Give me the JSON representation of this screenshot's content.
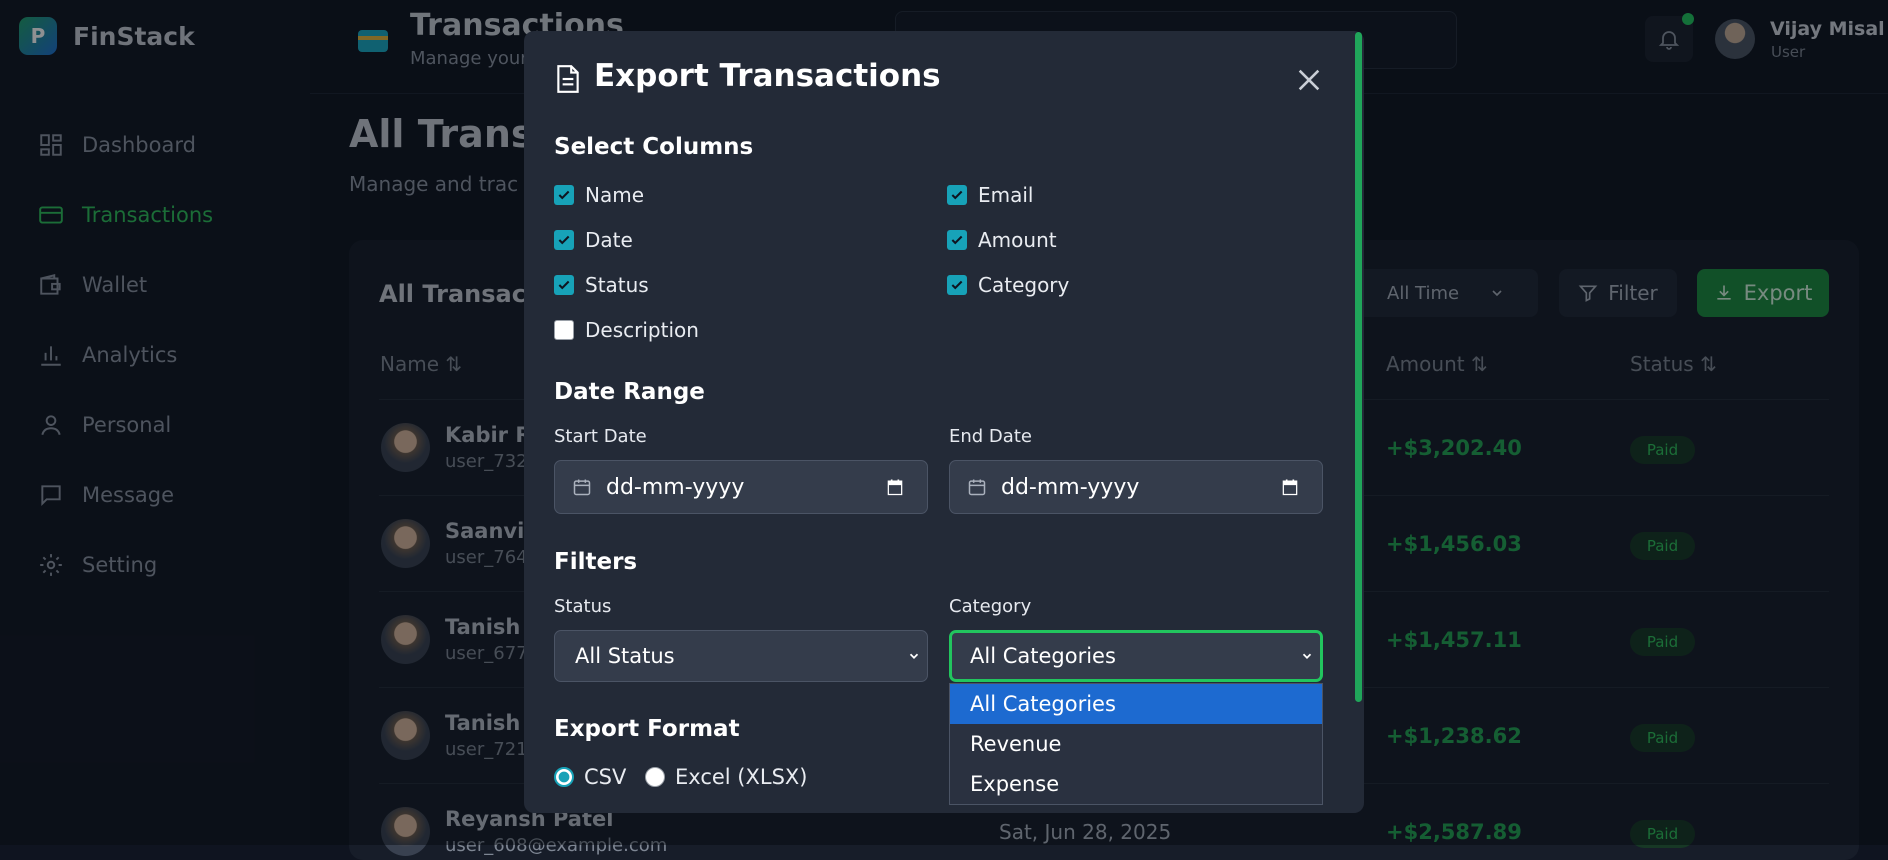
{
  "brand": {
    "logo_letter": "P",
    "name": "FinStack"
  },
  "sidebar": {
    "items": [
      {
        "label": "Dashboard",
        "icon": "dashboard-icon"
      },
      {
        "label": "Transactions",
        "icon": "card-icon"
      },
      {
        "label": "Wallet",
        "icon": "wallet-icon"
      },
      {
        "label": "Analytics",
        "icon": "bar-chart-icon"
      },
      {
        "label": "Personal",
        "icon": "user-icon"
      },
      {
        "label": "Message",
        "icon": "message-icon"
      },
      {
        "label": "Setting",
        "icon": "gear-icon"
      }
    ]
  },
  "header": {
    "title": "Transactions",
    "subtitle": "Manage your",
    "user": {
      "name": "Vijay Misal",
      "role": "User"
    }
  },
  "main": {
    "title": "All Transa",
    "subtitle": "Manage and trac",
    "card_title": "All Transac",
    "time_filter": "All Time",
    "filter_label": "Filter",
    "export_label": "Export",
    "columns": {
      "name": "Name ⇅",
      "amount": "Amount ⇅",
      "status": "Status ⇅"
    },
    "rows": [
      {
        "name": "Kabir Re",
        "email": "user_732",
        "date": "",
        "amount": "+$3,202.40",
        "status": "Paid"
      },
      {
        "name": "Saanvi I",
        "email": "user_764",
        "date": "",
        "amount": "+$1,456.03",
        "status": "Paid"
      },
      {
        "name": "Tanish F",
        "email": "user_677",
        "date": "",
        "amount": "+$1,457.11",
        "status": "Paid"
      },
      {
        "name": "Tanish N",
        "email": "user_721",
        "date": "",
        "amount": "+$1,238.62",
        "status": "Paid"
      },
      {
        "name": "Reyansh Patel",
        "email": "user_608@example.com",
        "date": "Sat, Jun 28, 2025",
        "amount": "+$2,587.89",
        "status": "Paid"
      }
    ]
  },
  "modal": {
    "title": "Export Transactions",
    "select_columns_title": "Select Columns",
    "columns": [
      {
        "label": "Name",
        "checked": true
      },
      {
        "label": "Email",
        "checked": true
      },
      {
        "label": "Date",
        "checked": true
      },
      {
        "label": "Amount",
        "checked": true
      },
      {
        "label": "Status",
        "checked": true
      },
      {
        "label": "Category",
        "checked": true
      },
      {
        "label": "Description",
        "checked": false
      }
    ],
    "date_range_title": "Date Range",
    "start_date_label": "Start Date",
    "end_date_label": "End Date",
    "start_date_placeholder": "dd-mm-yyyy",
    "end_date_placeholder": "dd-mm-yyyy",
    "filters_title": "Filters",
    "status_label": "Status",
    "status_value": "All Status",
    "category_label": "Category",
    "category_value": "All Categories",
    "category_options": [
      "All Categories",
      "Revenue",
      "Expense"
    ],
    "export_format_title": "Export Format",
    "formats": [
      {
        "label": "CSV",
        "selected": true
      },
      {
        "label": "Excel (XLSX)",
        "selected": false
      }
    ]
  },
  "colors": {
    "accent": "#22c55e",
    "checkbox": "#17a2b8",
    "option_highlight": "#1d6ad0",
    "modal_bg": "#232a37"
  }
}
